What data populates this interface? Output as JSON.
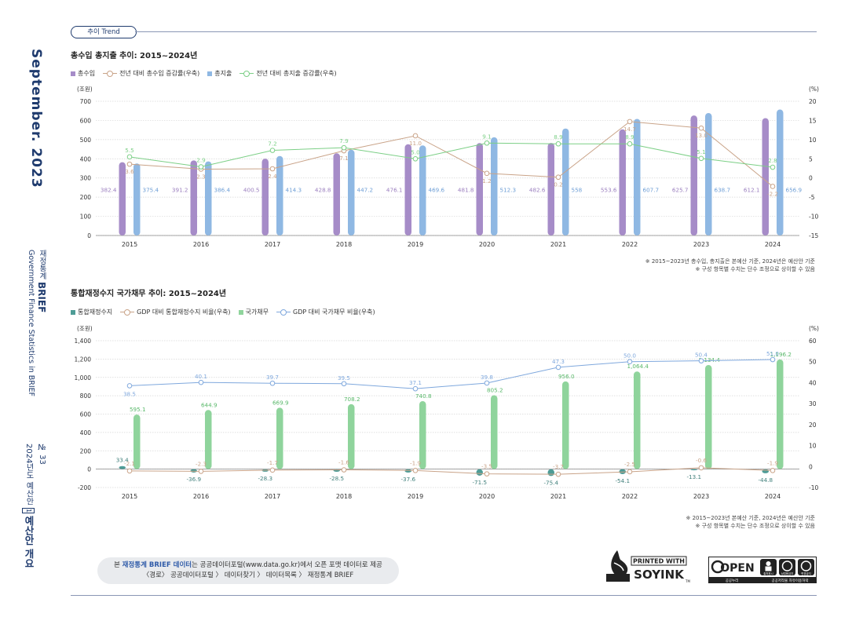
{
  "sidebar": {
    "month": "September. 2023",
    "sub_korean": "재정통계",
    "sub_brief": "BRIEF",
    "sub_english": "Government Finance Statistics in BRIEF",
    "issue_no": "№ 33",
    "issue_prefix": "2024년도 예산안",
    "issue_box": "1",
    "issue_title": "예산안 개요"
  },
  "section_tag": "추이 Trend",
  "footer": {
    "line1_pre": "본 ",
    "line1_hl": "재정통계 BRIEF 데이터",
    "line1_post": "는 공공데이터포털(www.data.go.kr)에서 오픈 포맷 데이터로 제공",
    "line2": "〈경로〉 공공데이터포털 〉 데이터찾기 〉 데이터목록 〉 재정통계 BRIEF",
    "soy_line1": "PRINTED WITH",
    "soy_line2": "SOYINK",
    "soy_tm": "TM",
    "open_label": "OPEN",
    "open_sub1": "공공누리",
    "open_sub2": "공공저작물 자유이용허락",
    "open_badges": [
      "출처표시",
      "상업용금지",
      "변경금지"
    ]
  },
  "colors": {
    "purple": "#a68cc8",
    "blue": "#8fb8e3",
    "tan": "#c9a388",
    "green_line": "#7ccf86",
    "teal": "#4e9c96",
    "green_bar": "#8fd49c",
    "sky_line": "#7fa8dd",
    "navy": "#1f3b6e"
  },
  "chart_data": [
    {
      "type": "bar",
      "title": "총수입 총지출 추이: 2015~2024년",
      "categories": [
        "2015",
        "2016",
        "2017",
        "2018",
        "2019",
        "2020",
        "2021",
        "2022",
        "2023",
        "2024"
      ],
      "ylabel_left": "(조원)",
      "ylabel_right": "(%)",
      "ylim": [
        0,
        700
      ],
      "y2lim": [
        -15,
        20
      ],
      "yticks": [
        "0",
        "100",
        "200",
        "300",
        "400",
        "500",
        "600",
        "700"
      ],
      "y2ticks": [
        "-15",
        "-10",
        "-5",
        "0",
        "5",
        "10",
        "15",
        "20"
      ],
      "series": [
        {
          "name": "총수입",
          "kind": "bar",
          "axis": "left",
          "values": [
            382.4,
            391.2,
            400.5,
            428.8,
            476.1,
            481.8,
            482.6,
            553.6,
            625.7,
            612.1
          ],
          "labels": [
            "382.4",
            "391.2",
            "400.5",
            "428.8",
            "476.1",
            "481.8",
            "482.6",
            "553.6",
            "625.7",
            "612.1"
          ]
        },
        {
          "name": "전년 대비 총수입 증감률(우축)",
          "kind": "line",
          "axis": "right",
          "values": [
            3.6,
            2.3,
            2.4,
            7.1,
            11.0,
            1.2,
            0.2,
            14.7,
            13.0,
            -2.2
          ],
          "labels": [
            "3.6",
            "2.3",
            "2.4",
            "7.1",
            "11.0",
            "1.2",
            "0.2",
            "14.7",
            "13.0",
            "-2.2"
          ]
        },
        {
          "name": "총지출",
          "kind": "bar",
          "axis": "left",
          "values": [
            375.4,
            386.4,
            414.3,
            447.2,
            469.6,
            512.3,
            558,
            607.7,
            638.7,
            656.9
          ],
          "labels": [
            "375.4",
            "386.4",
            "414.3",
            "447.2",
            "469.6",
            "512.3",
            "558",
            "607.7",
            "638.7",
            "656.9"
          ]
        },
        {
          "name": "전년 대비 총지출 증감률(우축)",
          "kind": "line",
          "axis": "right",
          "values": [
            5.5,
            2.9,
            7.2,
            7.9,
            5.0,
            9.1,
            8.9,
            8.9,
            5.1,
            2.8
          ],
          "labels": [
            "5.5",
            "2.9",
            "7.2",
            "7.9",
            "5.0",
            "9.1",
            "8.9",
            "8.9",
            "5.1",
            "2.8"
          ]
        }
      ],
      "notes": [
        "※ 2015~2023년 총수입, 총지출은 본예산 기준, 2024년은 예산안 기준",
        "※ 구성 항목별 수치는 단수 조정으로 상이할 수 있음"
      ]
    },
    {
      "type": "bar",
      "title": "통합재정수지 국가채무 추이: 2015~2024년",
      "categories": [
        "2015",
        "2016",
        "2017",
        "2018",
        "2019",
        "2020",
        "2021",
        "2022",
        "2023",
        "2024"
      ],
      "ylabel_left": "(조원)",
      "ylabel_right": "(%)",
      "ylim": [
        -200,
        1400
      ],
      "y2lim": [
        -10,
        60
      ],
      "yticks": [
        "-200",
        "0",
        "200",
        "400",
        "600",
        "800",
        "1,000",
        "1,200",
        "1,400"
      ],
      "y2ticks": [
        "-10",
        "0",
        "10",
        "20",
        "30",
        "40",
        "50",
        "60"
      ],
      "series": [
        {
          "name": "통합재정수지",
          "kind": "bar",
          "axis": "left",
          "values": [
            33.4,
            -36.9,
            -28.3,
            -28.5,
            -37.6,
            -71.5,
            -75.4,
            -54.1,
            -13.1,
            -44.8
          ],
          "labels": [
            "33.4",
            "-36.9",
            "-28.3",
            "-28.5",
            "-37.6",
            "-71.5",
            "-75.4",
            "-54.1",
            "-13.1",
            "-44.8"
          ]
        },
        {
          "name": "GDP 대비 통합재정수지 비율(우축)",
          "kind": "line",
          "axis": "right",
          "values": [
            -2.1,
            -2.3,
            -1.7,
            -1.6,
            -1.9,
            -3.5,
            -3.7,
            -2.5,
            -0.6,
            -1.9
          ],
          "labels": [
            "-2.1",
            "-2.3",
            "-1.7",
            "-1.6",
            "-1.9",
            "-3.5",
            "-3.7",
            "-2.5",
            "-0.6",
            "-1.9"
          ]
        },
        {
          "name": "국가채무",
          "kind": "bar",
          "axis": "left",
          "values": [
            595.1,
            644.9,
            669.9,
            708.2,
            740.8,
            805.2,
            956.0,
            1064.4,
            1134.4,
            1196.2
          ],
          "labels": [
            "595.1",
            "644.9",
            "669.9",
            "708.2",
            "740.8",
            "805.2",
            "956.0",
            "1,064.4",
            "1,134.4",
            "1,196.2"
          ]
        },
        {
          "name": "GDP 대비 국가채무 비율(우축)",
          "kind": "line",
          "axis": "right",
          "values": [
            38.5,
            40.1,
            39.7,
            39.5,
            37.1,
            39.8,
            47.3,
            50.0,
            50.4,
            51.0
          ],
          "labels": [
            "38.5",
            "40.1",
            "39.7",
            "39.5",
            "37.1",
            "39.8",
            "47.3",
            "50.0",
            "50.4",
            "51.0"
          ]
        }
      ],
      "notes": [
        "※ 2015~2023년 본예산 기준, 2024년은 예산안 기준",
        "※ 구성 항목별 수치는 단수 조정으로 상이할 수 있음"
      ]
    }
  ]
}
